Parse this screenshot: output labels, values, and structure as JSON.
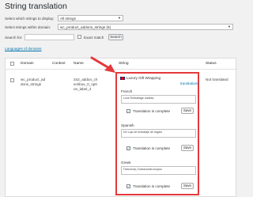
{
  "page": {
    "title": "String translation"
  },
  "filters": {
    "strings_label": "Select which strings to display:",
    "strings_value": "All strings",
    "domain_label": "Select strings within domain:",
    "domain_value": "wc_product_addons_strings (5)",
    "search_label": "Search for:",
    "search_value": "",
    "exact_label": "Exact match",
    "search_button": "Search",
    "languages_link": "Languages of domains"
  },
  "table": {
    "headers": {
      "domain": "Domain",
      "context": "Context",
      "name": "Name",
      "string": "String",
      "status": "Status"
    },
    "row": {
      "domain": [
        "wc_product_ad",
        "dons_strings"
      ],
      "context": "",
      "name": [
        "342_addon_ch",
        "eckbox_0_opti",
        "on_label_2"
      ],
      "string": "Luxury Gift Wrapping",
      "translations_link": "translations",
      "status": "Not translated"
    }
  },
  "translations": [
    {
      "language": "French",
      "value": "Luxe Emballage cadeau",
      "complete_label": "Translation is complete",
      "save_label": "Save"
    },
    {
      "language": "Spanish",
      "value": "De Lujo de embalaje de regalo",
      "complete_label": "Translation is complete",
      "save_label": "Save"
    },
    {
      "language": "Greek",
      "value": "Πολυτελής Συσκευασία Δώρου",
      "complete_label": "Translation is complete",
      "save_label": "Save"
    }
  ],
  "colors": {
    "highlight": "#e4393c",
    "link": "#0073aa",
    "check": "#1e8cbe"
  }
}
